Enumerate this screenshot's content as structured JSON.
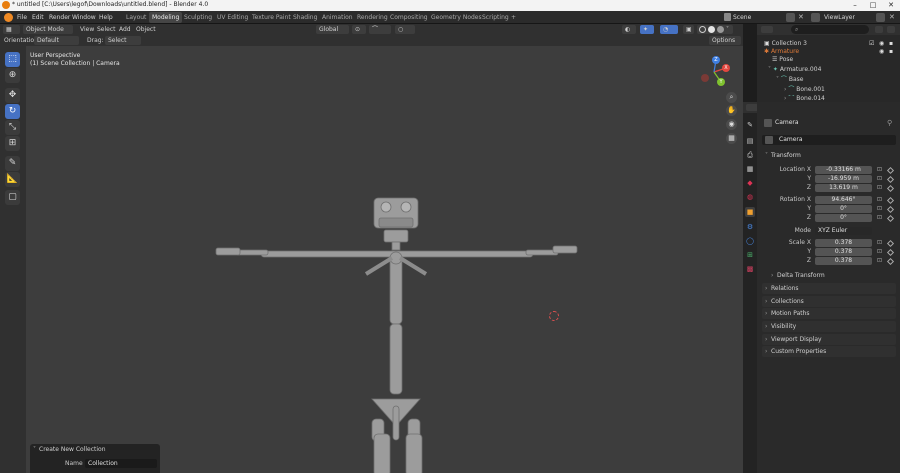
{
  "window": {
    "title": "* untitled [C:\\Users\\legof\\Downloads\\untitled.blend] - Blender 4.0"
  },
  "menu": [
    "File",
    "Edit",
    "Render",
    "Window",
    "Help"
  ],
  "workspaces": [
    "Layout",
    "Modeling",
    "Sculpting",
    "UV Editing",
    "Texture Paint",
    "Shading",
    "Animation",
    "Rendering",
    "Compositing",
    "Geometry Nodes",
    "Scripting"
  ],
  "workspace_add": "+",
  "scene": {
    "label": "Scene",
    "view_layer": "ViewLayer"
  },
  "viewport_header": {
    "mode": "Object Mode",
    "menus": [
      "View",
      "Select",
      "Add",
      "Object"
    ],
    "transform_orientation": "Global",
    "options_label": "Options"
  },
  "tool_settings": {
    "orientation_label": "Orientation:",
    "orientation_value": "Default",
    "drag_label": "Drag:",
    "drag_value": "Select Box"
  },
  "viewport": {
    "perspective": "User Perspective",
    "collection_info": "(1) Scene Collection | Camera"
  },
  "create_panel": {
    "title": "Create New Collection",
    "name_label": "Name",
    "name_value": "Collection"
  },
  "outliner": {
    "rows": [
      {
        "label": "Collection 3",
        "depth": 0
      },
      {
        "label": "Armature",
        "depth": 0
      },
      {
        "label": "Pose",
        "depth": 1
      },
      {
        "label": "Armature.004",
        "depth": 1
      },
      {
        "label": "Base",
        "depth": 2
      },
      {
        "label": "Bone.001",
        "depth": 3
      },
      {
        "label": "Bone.014",
        "depth": 3
      }
    ]
  },
  "properties": {
    "object_name": "Camera",
    "data_name": "Camera",
    "transform_title": "Transform",
    "location_label": "Location X",
    "location": [
      "-0.33166 m",
      "-16.959 m",
      "13.619 m"
    ],
    "rotation_label": "Rotation X",
    "rotation": [
      "94.646°",
      "0°",
      "0°"
    ],
    "mode_label": "Mode",
    "mode_value": "XYZ Euler",
    "scale_label": "Scale X",
    "scale": [
      "0.378",
      "0.378",
      "0.378"
    ],
    "axis_y": "Y",
    "axis_z": "Z",
    "delta_transform": "Delta Transform",
    "sections": [
      "Relations",
      "Collections",
      "Motion Paths",
      "Visibility",
      "Viewport Display",
      "Custom Properties"
    ]
  },
  "colors": {
    "accent": "#4672c4",
    "viewport_bg": "#3d3d3d",
    "gizmo_x": "#e2473f",
    "gizmo_y": "#7fc12f",
    "gizmo_z": "#3f7fe2"
  }
}
